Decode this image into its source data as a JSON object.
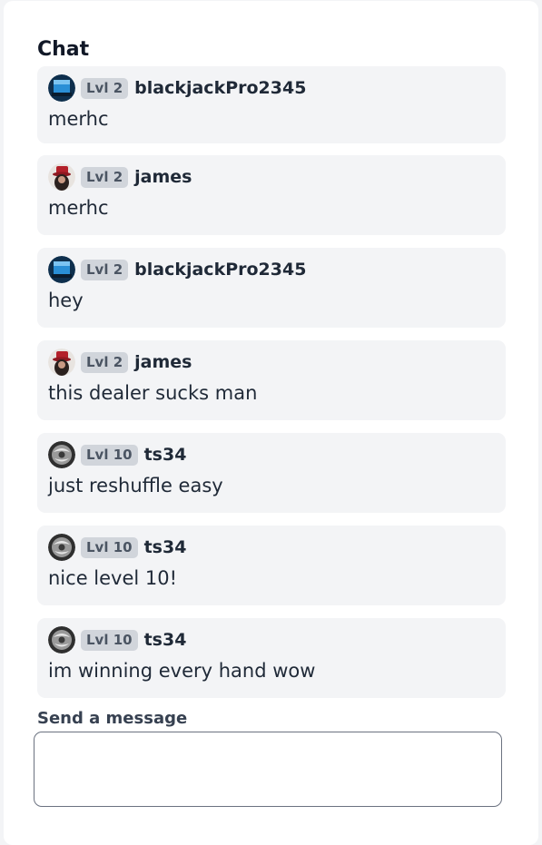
{
  "chat": {
    "title": "Chat",
    "messages": [
      {
        "avatar": "blue-screen-avatar-icon",
        "level": "Lvl 2",
        "username": "blackjackPro2345",
        "text": "merhc"
      },
      {
        "avatar": "red-hat-avatar-icon",
        "level": "Lvl 2",
        "username": "james",
        "text": "merhc"
      },
      {
        "avatar": "blue-screen-avatar-icon",
        "level": "Lvl 2",
        "username": "blackjackPro2345",
        "text": "hey"
      },
      {
        "avatar": "red-hat-avatar-icon",
        "level": "Lvl 2",
        "username": "james",
        "text": "this dealer sucks man"
      },
      {
        "avatar": "gray-swirl-avatar-icon",
        "level": "Lvl 10",
        "username": "ts34",
        "text": "just reshuffle easy"
      },
      {
        "avatar": "gray-swirl-avatar-icon",
        "level": "Lvl 10",
        "username": "ts34",
        "text": "nice level 10!"
      },
      {
        "avatar": "gray-swirl-avatar-icon",
        "level": "Lvl 10",
        "username": "ts34",
        "text": "im winning every hand wow"
      }
    ]
  },
  "composer": {
    "label": "Send a message",
    "value": "",
    "placeholder": ""
  },
  "colors": {
    "background": "#f3f4f6",
    "card": "#ffffff",
    "message_bubble": "#f3f4f6",
    "badge_bg": "#d1d5db",
    "badge_text": "#4b5563",
    "text": "#1f2937",
    "input_border": "#6b7280"
  }
}
